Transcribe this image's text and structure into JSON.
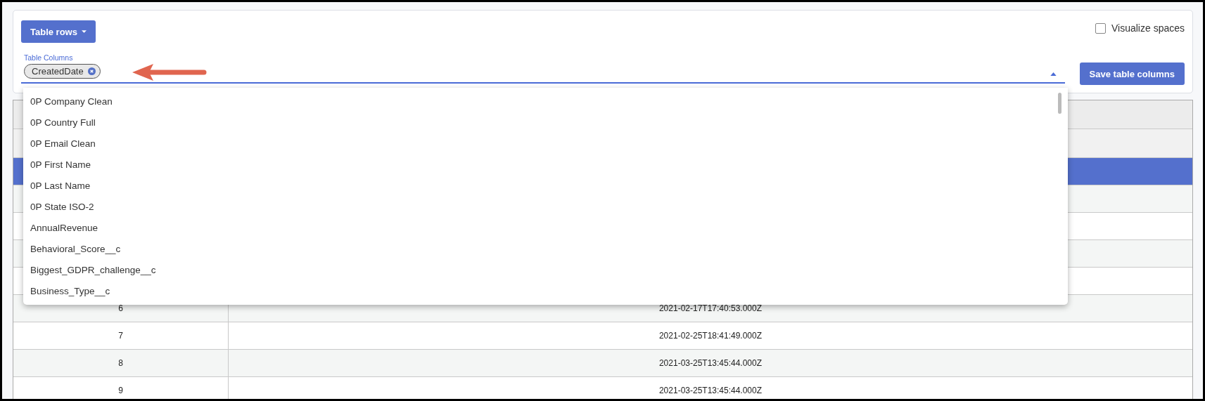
{
  "toolbar": {
    "rows_button": "Table rows",
    "visualize_spaces": {
      "label": "Visualize spaces",
      "checked": false
    }
  },
  "columns_select": {
    "label": "Table Columns",
    "chips": [
      "CreatedDate"
    ],
    "expanded": true,
    "save_button": "Save table columns",
    "options": [
      "0P Company Clean",
      "0P Country Full",
      "0P Email Clean",
      "0P First Name",
      "0P Last Name",
      "0P State ISO-2",
      "AnnualRevenue",
      "Behavioral_Score__c",
      "Biggest_GDPR_challenge__c",
      "Business_Type__c"
    ]
  },
  "table": {
    "rows": [
      {
        "kind": "header",
        "selected": false
      },
      {
        "kind": "filter",
        "selected": false
      },
      {
        "kind": "data",
        "selected": true
      },
      {
        "kind": "data",
        "selected": false
      },
      {
        "kind": "data",
        "selected": false
      },
      {
        "kind": "data",
        "selected": false
      },
      {
        "kind": "data",
        "selected": false
      },
      {
        "kind": "data",
        "selected": false,
        "cells": [
          "6",
          "2021-02-17T17:40:53.000Z"
        ]
      },
      {
        "kind": "data",
        "selected": false,
        "cells": [
          "7",
          "2021-02-25T18:41:49.000Z"
        ]
      },
      {
        "kind": "data",
        "selected": false,
        "cells": [
          "8",
          "2021-03-25T13:45:44.000Z"
        ]
      },
      {
        "kind": "data",
        "selected": false,
        "cells": [
          "9",
          "2021-03-25T13:45:44.000Z"
        ]
      }
    ]
  }
}
